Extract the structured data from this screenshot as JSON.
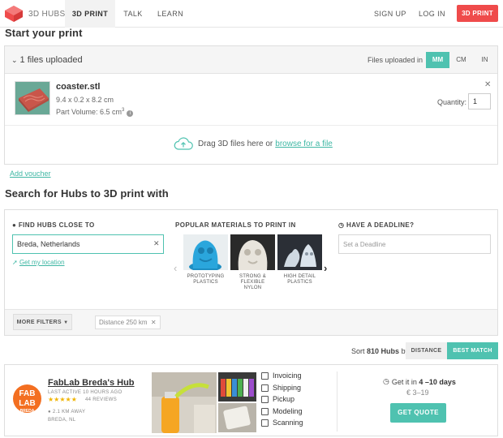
{
  "nav": {
    "brand": "3D HUBS",
    "tabs": [
      "3D PRINT",
      "TALK",
      "LEARN"
    ],
    "sign_up": "SIGN UP",
    "log_in": "LOG IN",
    "cta": "3D PRINT",
    "colors": {
      "cta": "#ef4b4b",
      "active_tab_bg": "#f2f2f2"
    }
  },
  "upload": {
    "heading": "Start your print",
    "files_uploaded": "1 files uploaded",
    "units_label": "Files uploaded in",
    "units": [
      "MM",
      "CM",
      "IN"
    ],
    "selected_unit": "MM",
    "file": {
      "name": "coaster.stl",
      "dimensions": "9.4 x 0.2 x 8.2 cm",
      "volume_prefix": "Part Volume: 6.5 cm",
      "volume_sup": "3",
      "quantity_label": "Quantity:",
      "quantity": "1"
    },
    "drag_text": "Drag 3D files here or",
    "browse_link": "browse for a file",
    "add_voucher": "Add voucher"
  },
  "search": {
    "heading": "Search for Hubs to 3D print with",
    "find_label": "FIND HUBS CLOSE TO",
    "location_value": "Breda, Netherlands",
    "get_location": "Get my location",
    "materials_label": "POPULAR MATERIALS TO PRINT IN",
    "materials": [
      {
        "line1": "PROTOTYPING",
        "line2": "PLASTICS",
        "line3": ""
      },
      {
        "line1": "STRONG &",
        "line2": "FLEXIBLE",
        "line3": "NYLON"
      },
      {
        "line1": "HIGH DETAIL",
        "line2": "PLASTICS",
        "line3": ""
      }
    ],
    "deadline_label": "HAVE A DEADLINE?",
    "deadline_placeholder": "Set a Deadline",
    "more_filters": "MORE FILTERS",
    "distance_chip": "Distance 250 km"
  },
  "sort": {
    "prefix": "Sort",
    "count": "810 Hubs",
    "suffix": "by",
    "options": [
      "DISTANCE",
      "BEST MATCH"
    ],
    "selected": "BEST MATCH",
    "accent": "#4fc2b0"
  },
  "hub": {
    "logo_line1": "FAB",
    "logo_line2": "LAB",
    "logo_sub": "BREDA",
    "name": "FabLab Breda's Hub",
    "last_active": "LAST ACTIVE 10 HOURS AGO",
    "stars": "★★★★★",
    "reviews": "44 REVIEWS",
    "distance": "2.1 KM AWAY",
    "city": "BREDA, NL",
    "services": [
      "Invoicing",
      "Shipping",
      "Pickup",
      "Modeling",
      "Scanning"
    ],
    "get_it_prefix": "Get it in",
    "get_it_days": "4 –10 days",
    "price": "€ 3–19",
    "get_quote": "GET QUOTE"
  }
}
